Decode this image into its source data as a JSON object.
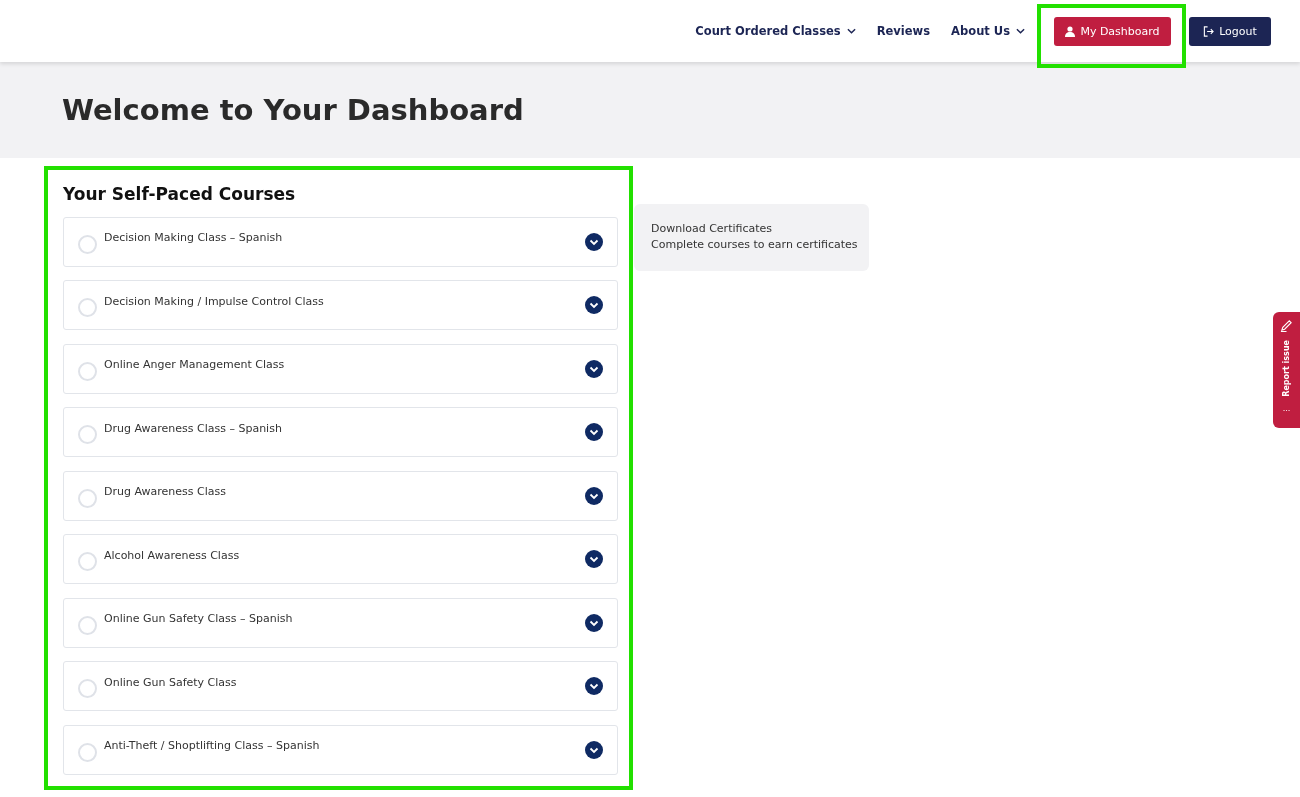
{
  "nav": {
    "items": [
      {
        "label": "Court Ordered Classes",
        "dropdown": true
      },
      {
        "label": "Reviews",
        "dropdown": false
      },
      {
        "label": "About Us",
        "dropdown": true
      }
    ],
    "dashboard_button": {
      "label": "My Dashboard",
      "highlighted": true
    },
    "logout_button": {
      "label": "Logout"
    }
  },
  "hero": {
    "title": "Welcome to Your Dashboard"
  },
  "courses": {
    "title": "Your Self-Paced Courses",
    "highlighted": true,
    "items": [
      {
        "name": "Decision Making Class – Spanish",
        "completed": false,
        "expanded": false
      },
      {
        "name": "Decision Making / Impulse Control Class",
        "completed": false,
        "expanded": false
      },
      {
        "name": "Online Anger Management Class",
        "completed": false,
        "expanded": false
      },
      {
        "name": "Drug Awareness Class – Spanish",
        "completed": false,
        "expanded": false
      },
      {
        "name": "Drug Awareness Class",
        "completed": false,
        "expanded": false
      },
      {
        "name": "Alcohol Awareness Class",
        "completed": false,
        "expanded": false
      },
      {
        "name": "Online Gun Safety Class – Spanish",
        "completed": false,
        "expanded": false
      },
      {
        "name": "Online Gun Safety Class",
        "completed": false,
        "expanded": false
      },
      {
        "name": "Anti-Theft / Shoptlifting Class – Spanish",
        "completed": false,
        "expanded": false
      }
    ]
  },
  "certificates": {
    "title": "Download Certificates",
    "note": "Complete courses to earn certificates"
  },
  "report_tab": {
    "label": "Report issue",
    "more": "..."
  }
}
